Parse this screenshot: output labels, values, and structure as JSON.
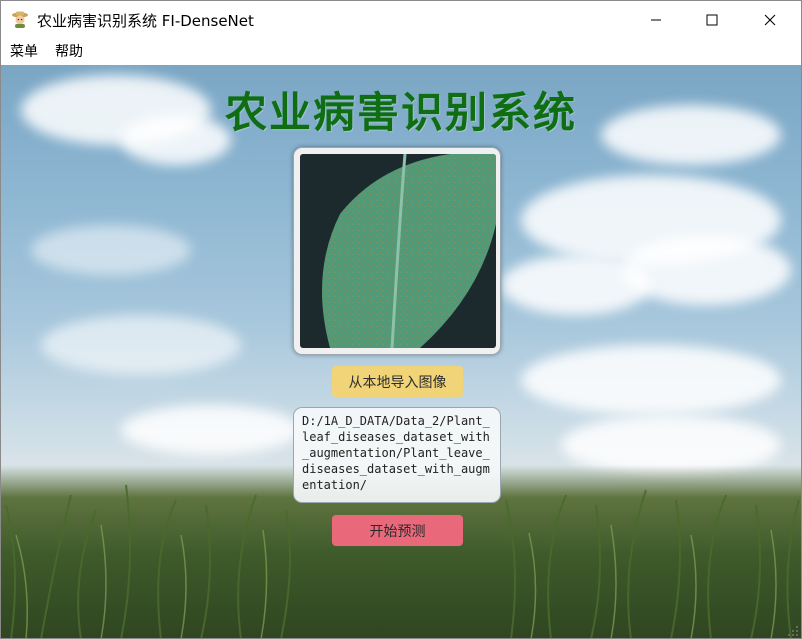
{
  "window": {
    "title": "农业病害识别系统 FI-DenseNet",
    "icon": "farmer-avatar-icon"
  },
  "menubar": {
    "items": [
      {
        "label": "菜单"
      },
      {
        "label": "帮助"
      }
    ]
  },
  "main": {
    "heading": "农业病害识别系统",
    "import_button": "从本地导入图像",
    "path_text": "D:/1A_D_DATA/Data_2/Plant_leaf_diseases_dataset_with_augmentation/Plant_leave_diseases_dataset_with_augmentation/",
    "predict_button": "开始预测"
  },
  "colors": {
    "heading": "#0f6e12",
    "import_button": "#f2d478",
    "predict_button": "#e9697a"
  }
}
